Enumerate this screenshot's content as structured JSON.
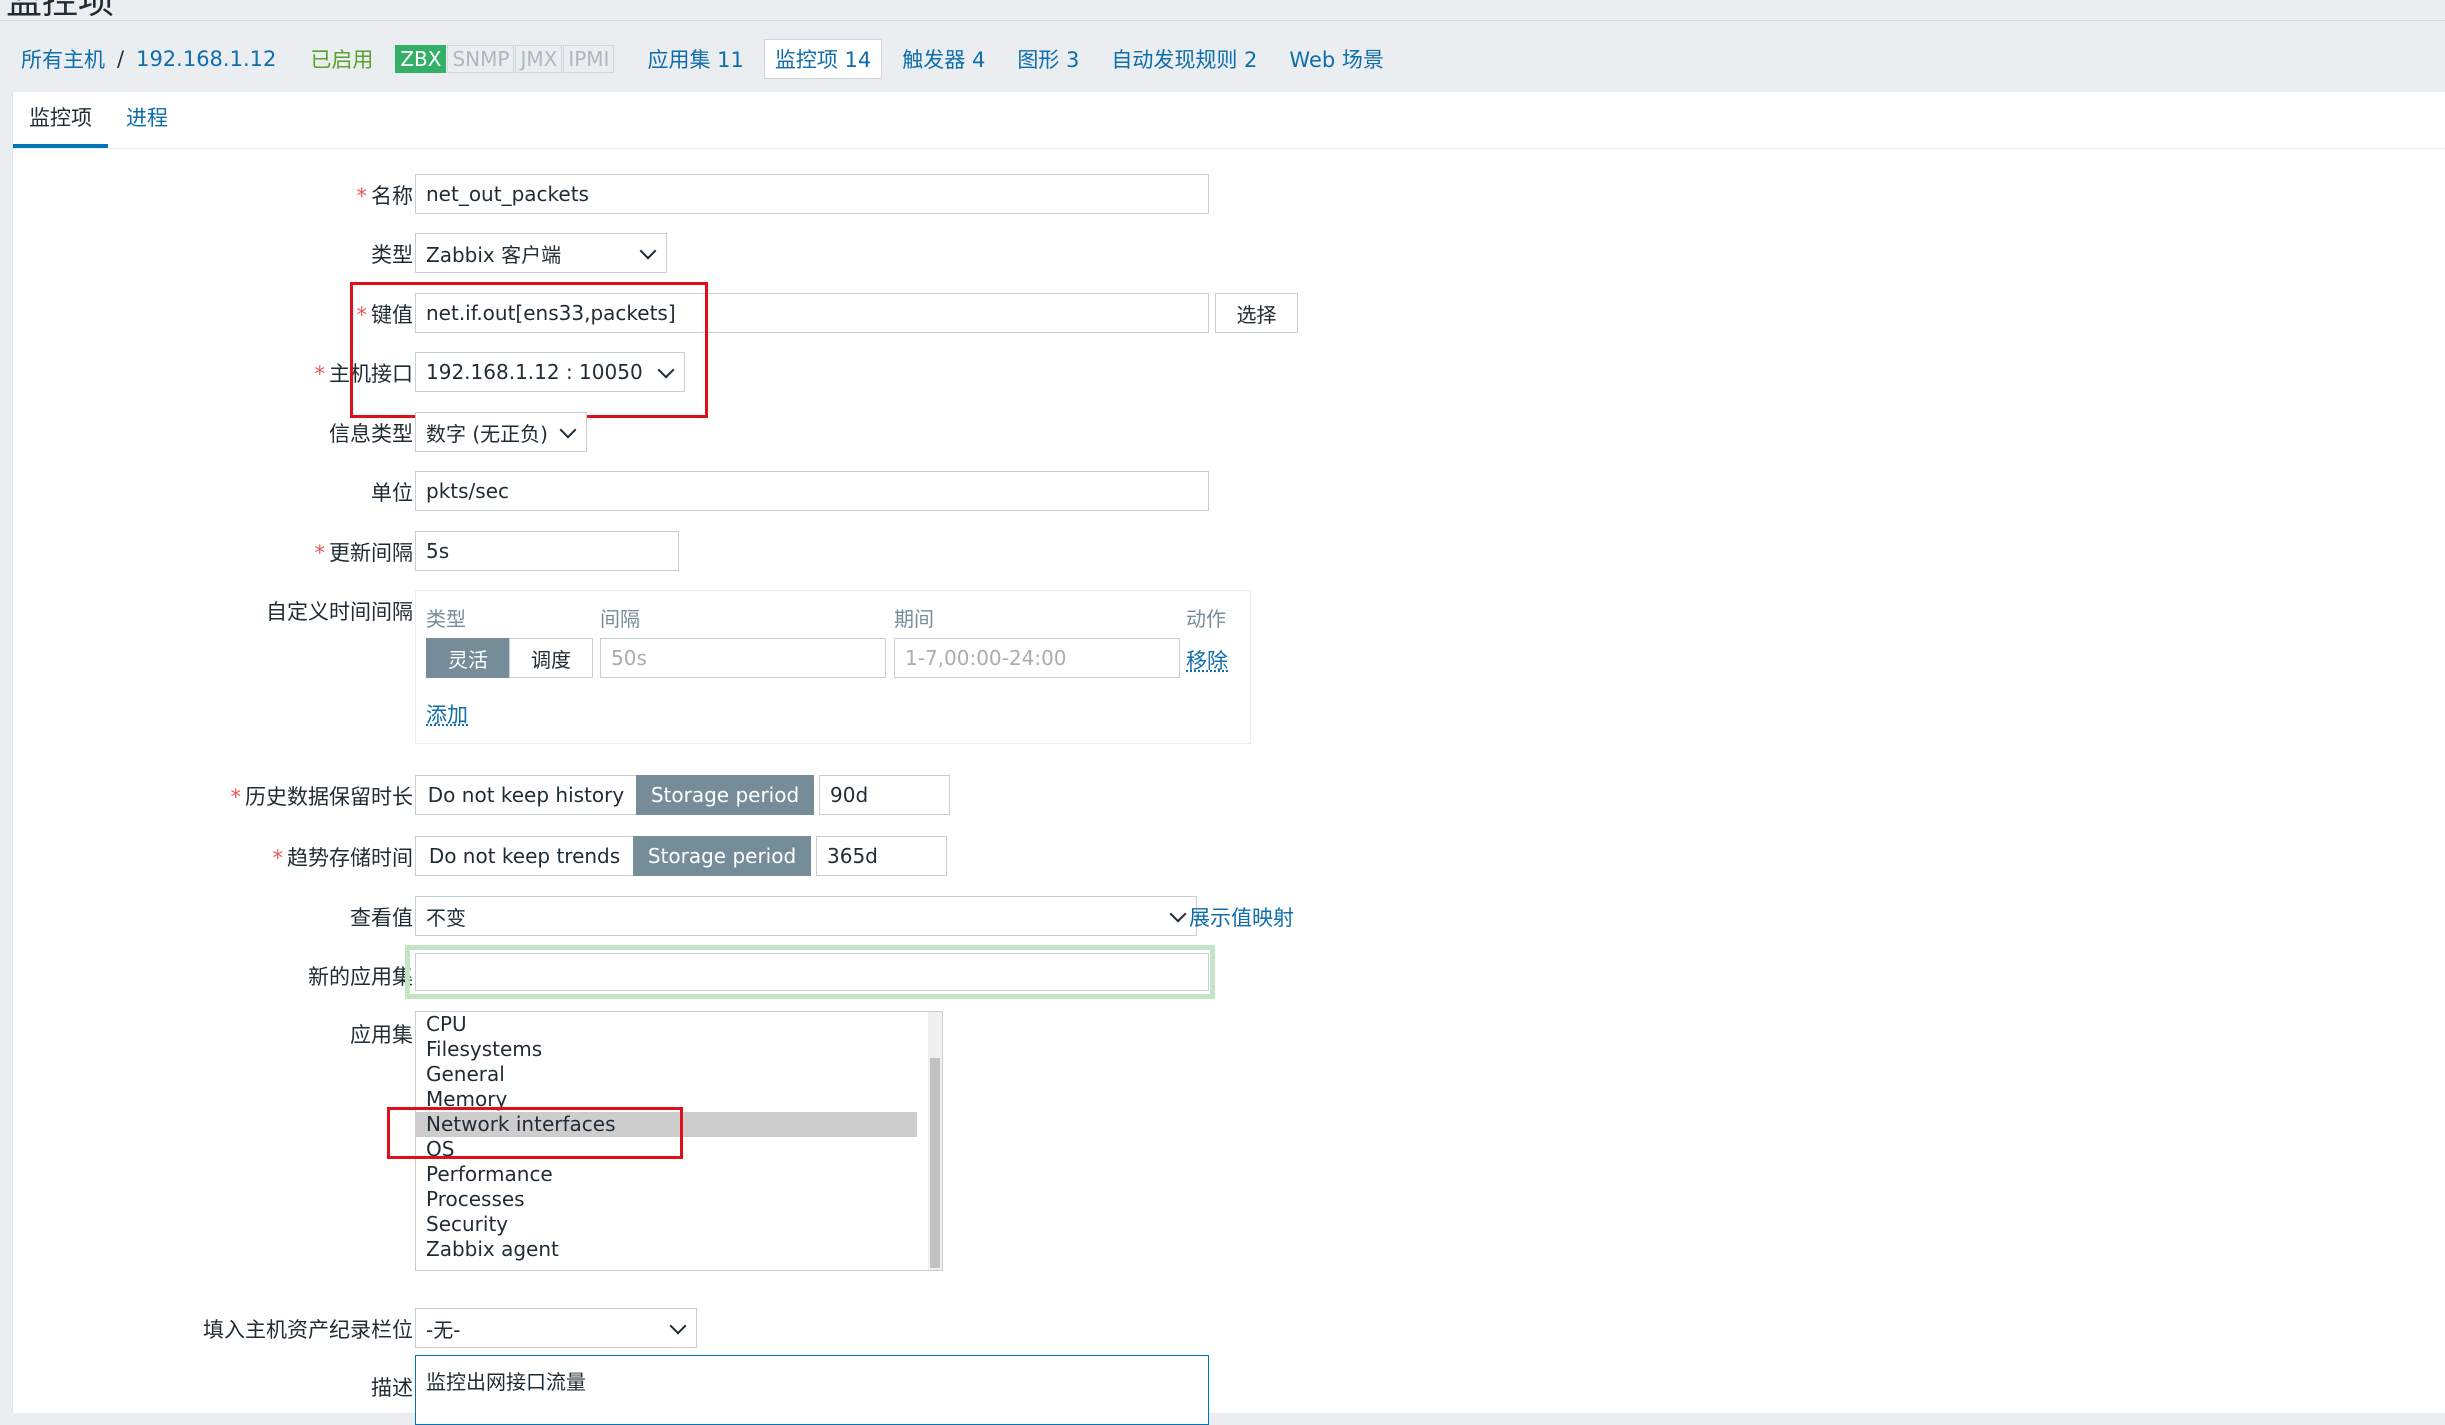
{
  "page": {
    "title": "监控项"
  },
  "hostnav": {
    "all_hosts": "所有主机",
    "separator": "/",
    "host": "192.168.1.12",
    "status": "已启用",
    "availability": [
      "ZBX",
      "SNMP",
      "JMX",
      "IPMI"
    ],
    "tabs": [
      {
        "label": "应用集 11"
      },
      {
        "label": "监控项 14"
      },
      {
        "label": "触发器 4"
      },
      {
        "label": "图形 3"
      },
      {
        "label": "自动发现规则 2"
      },
      {
        "label": "Web 场景"
      }
    ]
  },
  "form_tabs": [
    "监控项",
    "进程"
  ],
  "form": {
    "name": {
      "label": "名称",
      "value": "net_out_packets",
      "required": true
    },
    "type": {
      "label": "类型",
      "value": "Zabbix 客户端"
    },
    "key": {
      "label": "键值",
      "value": "net.if.out[ens33,packets]",
      "select_button": "选择",
      "required": true
    },
    "interface": {
      "label": "主机接口",
      "value": "192.168.1.12 : 10050",
      "required": true
    },
    "info_type": {
      "label": "信息类型",
      "value": "数字 (无正负)"
    },
    "units": {
      "label": "单位",
      "value": "pkts/sec"
    },
    "interval": {
      "label": "更新间隔",
      "value": "5s",
      "required": true
    },
    "custom_intervals": {
      "label": "自定义时间间隔",
      "headers": {
        "type": "类型",
        "interval": "间隔",
        "period": "期间",
        "action": "动作"
      },
      "type_options": [
        "灵活",
        "调度"
      ],
      "interval_placeholder": "50s",
      "period_placeholder": "1-7,00:00-24:00",
      "remove": "移除",
      "add": "添加"
    },
    "history": {
      "label": "历史数据保留时长",
      "options": [
        "Do not keep history",
        "Storage period"
      ],
      "value": "90d",
      "required": true
    },
    "trends": {
      "label": "趋势存储时间",
      "options": [
        "Do not keep trends",
        "Storage period"
      ],
      "value": "365d",
      "required": true
    },
    "valuemap": {
      "label": "查看值",
      "value": "不变",
      "link": "展示值映射"
    },
    "new_application": {
      "label": "新的应用集",
      "value": ""
    },
    "applications": {
      "label": "应用集",
      "items": [
        "CPU",
        "Filesystems",
        "General",
        "Memory",
        "Network interfaces",
        "OS",
        "Performance",
        "Processes",
        "Security",
        "Zabbix agent"
      ],
      "selected": "Network interfaces"
    },
    "inventory": {
      "label": "填入主机资产纪录栏位",
      "value": "-无-"
    },
    "description": {
      "label": "描述",
      "value": "监控出网接口流量"
    }
  }
}
